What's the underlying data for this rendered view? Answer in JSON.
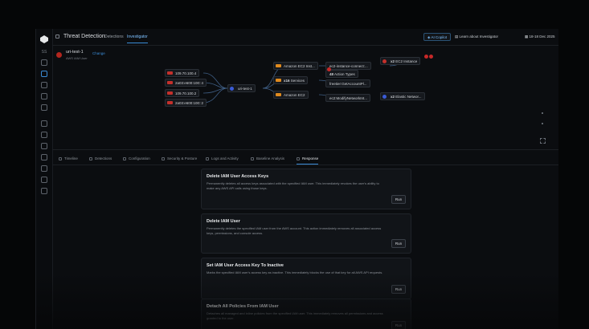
{
  "rail": {
    "label": "SS"
  },
  "topbar": {
    "title": "Threat Detection",
    "tabs": [
      {
        "label": "Detections",
        "active": false
      },
      {
        "label": "Investigator",
        "active": true
      }
    ],
    "ai_copilot_label": "AI Copilot",
    "learn_label": "Learn about Investigator",
    "date_range": "18-18 Dec 2025"
  },
  "resource": {
    "name": "uri-test-1",
    "subtitle": "AWS IAM User",
    "change_label": "Change"
  },
  "graph": {
    "ips": [
      "109.70.100.4",
      "2a03:e600:100::4",
      "109.70.100.2",
      "2a03:e600:100::2"
    ],
    "center": "uri-test-1",
    "mid": [
      {
        "label": "Amazon EC2 Inst...",
        "count": ""
      },
      {
        "label": "Services",
        "count": "x16"
      },
      {
        "label": "Amazon EC2",
        "count": ""
      }
    ],
    "actions": [
      {
        "label": "ec2-instance-connect:...",
        "count": ""
      },
      {
        "label": "Action Types",
        "count": "48"
      },
      {
        "label": "freetier:GetAccountPl...",
        "count": ""
      },
      {
        "label": "ec2:ModifyNetworkInt...",
        "count": ""
      }
    ],
    "targets": [
      {
        "label": "EC2 Instance",
        "count": "x2"
      },
      {
        "label": "Elastic Networ...",
        "count": "x2"
      }
    ]
  },
  "tabs": [
    {
      "label": "Timeline",
      "active": false
    },
    {
      "label": "Detections",
      "active": false
    },
    {
      "label": "Configuration",
      "active": false
    },
    {
      "label": "Security & Posture",
      "active": false
    },
    {
      "label": "Logs and Activity",
      "active": false
    },
    {
      "label": "Baseline Analysis",
      "active": false
    },
    {
      "label": "Response",
      "active": true
    }
  ],
  "responses": [
    {
      "title": "Delete IAM User Access Keys",
      "desc": "Permanently deletes all access keys associated with the specified IAM user. This immediately revokes the user's ability to make any AWS API calls using those keys.",
      "run": "Run"
    },
    {
      "title": "Delete IAM User",
      "desc": "Permanently deletes the specified IAM user from the AWS account. This action immediately removes all associated access keys, permissions, and console access.",
      "run": "Run"
    },
    {
      "title": "Set IAM User Access Key To Inactive",
      "desc": "Marks the specified IAM user's access key as inactive. This immediately blocks the use of that key for all AWS API requests.",
      "run": "Run"
    },
    {
      "title": "Detach All Policies From IAM User",
      "desc": "Detaches all managed and inline policies from the specified IAM user. This immediately removes all permissions and access granted to the user.",
      "run": "Run"
    }
  ]
}
